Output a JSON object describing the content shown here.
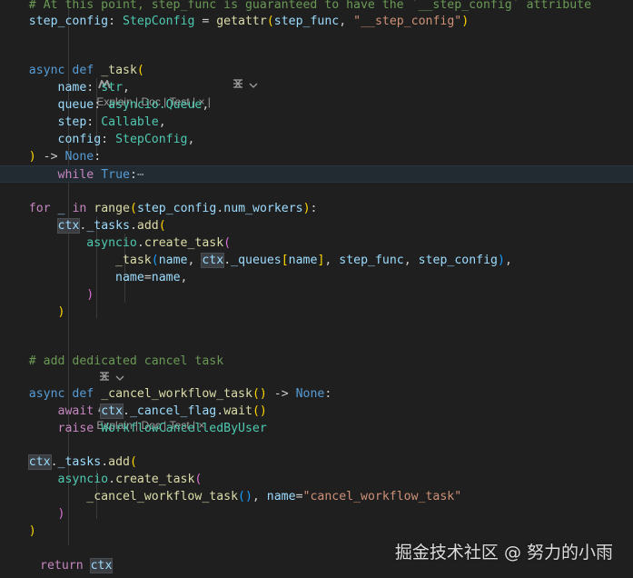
{
  "codelens_explain": "Explain",
  "codelens_doc": "Doc",
  "codelens_test": "Test",
  "codelens_sep": " | ",
  "codelens_close": "×",
  "codelens_chevron": "⌵",
  "icons": {
    "codelens_logo": "m-logo-icon",
    "codelens_ai": "sparkle-icon"
  },
  "code": {
    "l1_comment": "# At this point, step_func is guaranteed to have the `__step_config` attribute",
    "l2_var": "step_config",
    "l2_type": "StepConfig",
    "l2_fn": "getattr",
    "l2_arg": "step_func",
    "l2_str": "\"__step_config\"",
    "l3_async": "async",
    "l3_def": "def",
    "l3_fn": "_task",
    "p_name": "name",
    "p_name_t": "str",
    "p_queue": "queue",
    "p_queue_t": "asyncio.Queue",
    "p_step": "step",
    "p_step_t": "Callable",
    "p_config": "config",
    "p_config_t": "StepConfig",
    "ret_none": "None",
    "while_kw": "while",
    "while_true": "True",
    "fold_ellipsis": "⋯",
    "for_kw": "for",
    "for_var": "_",
    "in_kw": "in",
    "range_fn": "range",
    "step_config": "step_config",
    "num_workers": "num_workers",
    "ctx": "ctx",
    "tasks_attr": "_tasks",
    "add_fn": "add",
    "asyncio": "asyncio",
    "create_task": "create_task",
    "task_fn": "_task",
    "name_var": "name",
    "queues_attr": "_queues",
    "step_func": "step_func",
    "name_kw": "name",
    "comment_cancel": "# add dedicated cancel task",
    "cancel_fn": "_cancel_workflow_task",
    "await_kw": "await",
    "cancel_flag": "_cancel_flag",
    "wait_fn": "wait",
    "raise_kw": "raise",
    "exc_cls": "WorkflowCancelledByUser",
    "cancel_str": "\"cancel_workflow_task\"",
    "return_kw": "return"
  },
  "watermark": "掘金技术社区 @ 努力的小雨"
}
